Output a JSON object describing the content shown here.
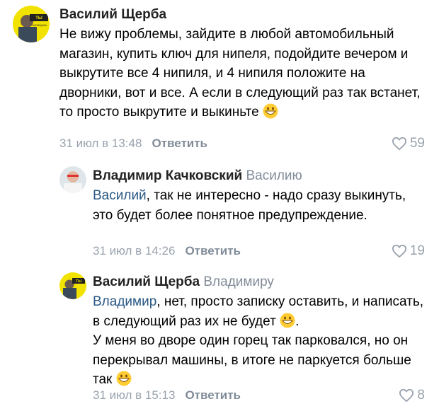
{
  "comments": [
    {
      "author": "Василий Щерба",
      "reply_to": "",
      "mention": "",
      "text": "Не вижу проблемы, зайдите в любой автомобильный магазин, купить ключ для нипеля, подойдите вечером и выкрутите все 4 нипиля, и 4 нипиля положите на дворники, вот и все. А если в следующий раз так встанет, то просто выкрутите и выкиньте",
      "emoji": "grinning-face",
      "date": "31 июл в 13:48",
      "reply_label": "Ответить",
      "likes": "59",
      "avatar_text": "ТЫ НАПИЩИШЬ ПОЛЕМИЧЕСКИ"
    },
    {
      "author": "Владимир Качковский",
      "reply_to": "Василию",
      "mention": "Василий",
      "text": ", так не интересно - надо сразу выкинуть, это будет более понятное предупреждение.",
      "date": "31 июл в 14:26",
      "reply_label": "Ответить",
      "likes": "19"
    },
    {
      "author": "Василий Щерба",
      "reply_to": "Владимиру",
      "mention": "Владимир",
      "text_part1": ", нет, просто записку оставить, и написать, в следующий раз их не будет",
      "text_part2": "У меня во дворе один горец так парковался, но он перекрывал машины, в итоге не паркуется больше так",
      "date": "31 июл в 15:13",
      "reply_label": "Ответить",
      "likes": "8",
      "avatar_text": "ТЫ НАПИЩИШЬ ПОЛЕМИЧЕСКИ"
    }
  ],
  "colors": {
    "link": "#2a5885",
    "meta": "#99a2ad",
    "avatar_yellow": "#f2e200"
  }
}
